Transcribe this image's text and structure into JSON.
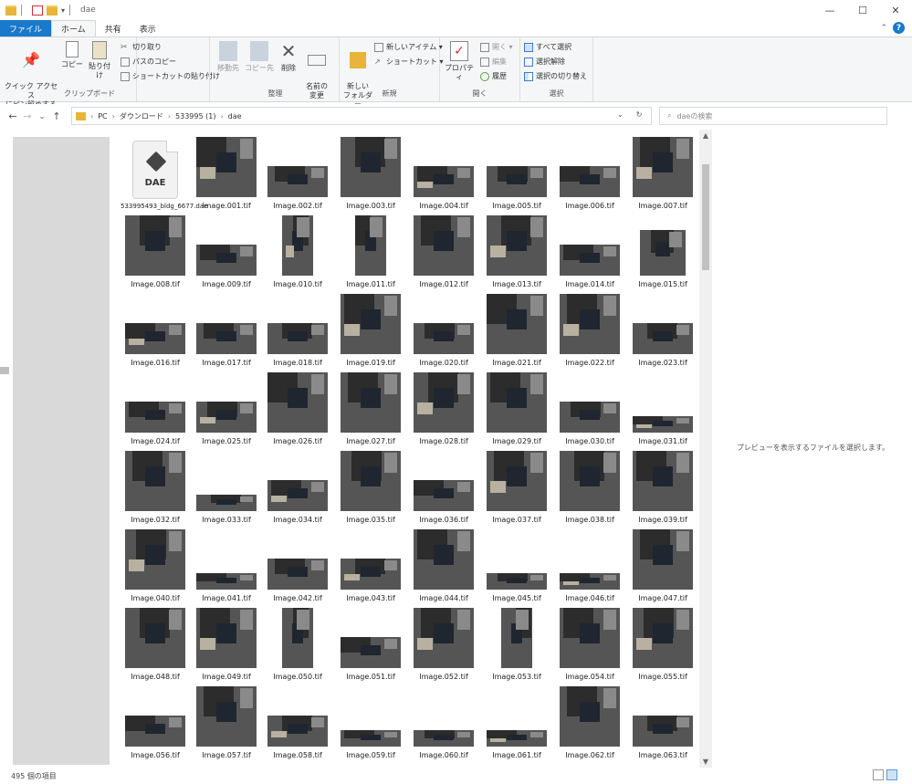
{
  "window": {
    "title": "dae",
    "minimize": "—",
    "maximize": "☐",
    "close": "✕"
  },
  "ribbon_tabs": [
    {
      "label": "ファイル"
    },
    {
      "label": "ホーム"
    },
    {
      "label": "共有"
    },
    {
      "label": "表示"
    }
  ],
  "ribbon": {
    "quick_access": "クイック アクセス\nにピン留めする",
    "copy": "コピー",
    "paste": "貼り付け",
    "cut": "切り取り",
    "copy_path": "パスのコピー",
    "paste_shortcut": "ショートカットの貼り付け",
    "clipboard_group": "クリップボード",
    "move_to": "移動先",
    "copy_to": "コピー先",
    "delete": "削除",
    "rename": "名前の\n変更",
    "organize_group": "整理",
    "new_folder": "新しい\nフォルダー",
    "new_item": "新しいアイテム ▾",
    "shortcut": "ショートカット ▾",
    "new_group": "新規",
    "properties": "プロパティ",
    "open": "開く ▾",
    "edit": "編集",
    "history": "履歴",
    "open_group": "開く",
    "select_all": "すべて選択",
    "select_none": "選択解除",
    "invert_selection": "選択の切り替え",
    "select_group": "選択"
  },
  "address": {
    "crumbs": [
      "PC",
      "ダウンロード",
      "533995 (1)",
      "dae"
    ],
    "search_placeholder": "daeの検索"
  },
  "files": {
    "dae_name": "533995493_bldg_6677.dae",
    "dae_badge": "DAE",
    "images": [
      "Image.001.tif",
      "Image.002.tif",
      "Image.003.tif",
      "Image.004.tif",
      "Image.005.tif",
      "Image.006.tif",
      "Image.007.tif",
      "Image.008.tif",
      "Image.009.tif",
      "Image.010.tif",
      "Image.011.tif",
      "Image.012.tif",
      "Image.013.tif",
      "Image.014.tif",
      "Image.015.tif",
      "Image.016.tif",
      "Image.017.tif",
      "Image.018.tif",
      "Image.019.tif",
      "Image.020.tif",
      "Image.021.tif",
      "Image.022.tif",
      "Image.023.tif",
      "Image.024.tif",
      "Image.025.tif",
      "Image.026.tif",
      "Image.027.tif",
      "Image.028.tif",
      "Image.029.tif",
      "Image.030.tif",
      "Image.031.tif",
      "Image.032.tif",
      "Image.033.tif",
      "Image.034.tif",
      "Image.035.tif",
      "Image.036.tif",
      "Image.037.tif",
      "Image.038.tif",
      "Image.039.tif",
      "Image.040.tif",
      "Image.041.tif",
      "Image.042.tif",
      "Image.043.tif",
      "Image.044.tif",
      "Image.045.tif",
      "Image.046.tif",
      "Image.047.tif",
      "Image.048.tif",
      "Image.049.tif",
      "Image.050.tif",
      "Image.051.tif",
      "Image.052.tif",
      "Image.053.tif",
      "Image.054.tif",
      "Image.055.tif",
      "Image.056.tif",
      "Image.057.tif",
      "Image.058.tif",
      "Image.059.tif",
      "Image.060.tif",
      "Image.061.tif",
      "Image.062.tif",
      "Image.063.tif"
    ]
  },
  "preview": {
    "message": "プレビューを表示するファイルを選択します。"
  },
  "status": {
    "count": "495 個の項目"
  },
  "colors": {
    "accent": "#1979ca",
    "nav_pane": "#d9d9d9",
    "thumb_base": "#555555"
  }
}
